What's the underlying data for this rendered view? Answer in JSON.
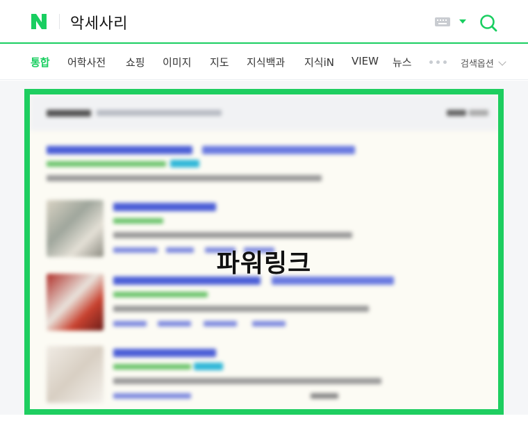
{
  "search": {
    "query": "악세사리"
  },
  "tabs": [
    {
      "label": "통합",
      "active": true
    },
    {
      "label": "어학사전",
      "active": false
    },
    {
      "label": "쇼핑",
      "active": false
    },
    {
      "label": "이미지",
      "active": false
    },
    {
      "label": "지도",
      "active": false
    },
    {
      "label": "지식백과",
      "active": false
    },
    {
      "label": "지식iN",
      "active": false
    },
    {
      "label": "VIEW",
      "active": false
    },
    {
      "label": "뉴스",
      "active": false
    }
  ],
  "search_options_label": "검색옵션",
  "power_link": {
    "overlay_label": "파워링크"
  },
  "colors": {
    "brand_green": "#19ce60",
    "highlight_border": "#1ece60"
  },
  "icons": [
    "naver-logo-icon",
    "keyboard-icon",
    "dropdown-caret-icon",
    "search-icon",
    "more-dots-icon",
    "chevron-down-icon"
  ]
}
